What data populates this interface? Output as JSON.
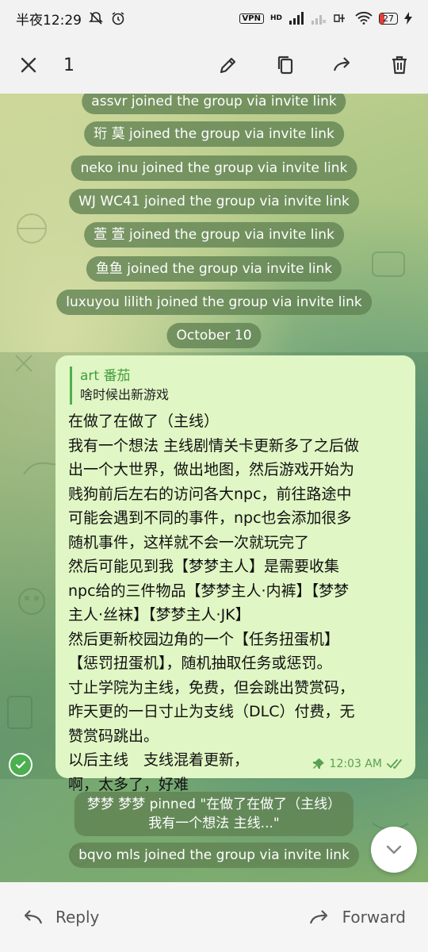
{
  "status_bar": {
    "time": "半夜12:29",
    "vpn": "VPN",
    "network": "HD",
    "battery": "27"
  },
  "toolbar": {
    "selected_count": "1"
  },
  "service_messages": [
    {
      "text": "assvr joined the group via invite link"
    },
    {
      "text": "珩 莫 joined the group via invite link"
    },
    {
      "text": "neko inu joined the group via invite link"
    },
    {
      "text": "WJ WC41 joined the group via invite link"
    },
    {
      "text": "萱 萱 joined the group via invite link"
    },
    {
      "text": "鱼鱼 joined the group via invite link"
    },
    {
      "text": "luxuyou lilith joined the group via invite link"
    }
  ],
  "date_separator": "October 10",
  "message": {
    "reply_name": "art 番茄",
    "reply_text": "啥时候出新游戏",
    "text": "在做了在做了（主线）\n我有一个想法 主线剧情关卡更新多了之后做\n出一个大世界，做出地图，然后游戏开始为\n贱狗前后左右的访问各大npc，前往路途中\n可能会遇到不同的事件，npc也会添加很多\n随机事件，这样就不会一次就玩完了\n然后可能见到我【梦梦主人】是需要收集\nnpc给的三件物品【梦梦主人·内裤】【梦梦\n主人·丝袜】【梦梦主人·JK】\n然后更新校园边角的一个【任务扭蛋机】\n【惩罚扭蛋机】，随机抽取任务或惩罚。\n寸止学院为主线，免费，但会跳出赞赏码，\n昨天更的一日寸止为支线（DLC）付费，无\n赞赏码跳出。\n以后主线　支线混着更新，\n啊，太多了，好难",
    "time": "12:03 AM"
  },
  "pinned_notice": {
    "line1": "梦梦 梦梦 pinned \"在做了在做了（主线）",
    "line2": "我有一个想法 主线...\""
  },
  "after_message": "bqvo mls joined the group via invite link",
  "bottom_bar": {
    "reply_label": "Reply",
    "forward_label": "Forward"
  },
  "colors": {
    "accent_green": "#4caf50",
    "bubble": "#e0f6c4",
    "service_pill": "#60824e"
  }
}
